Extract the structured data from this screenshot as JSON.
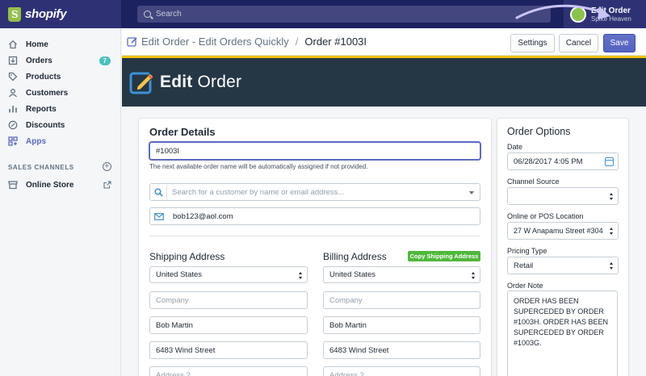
{
  "topbar": {
    "brand": "shopify",
    "search_placeholder": "Search",
    "user_name": "Edit Order",
    "store_name": "Spike Heaven"
  },
  "sidebar": {
    "items": [
      {
        "label": "Home",
        "icon": "home-icon"
      },
      {
        "label": "Orders",
        "icon": "orders-icon",
        "badge": "7"
      },
      {
        "label": "Products",
        "icon": "tag-icon"
      },
      {
        "label": "Customers",
        "icon": "customers-icon"
      },
      {
        "label": "Reports",
        "icon": "reports-icon"
      },
      {
        "label": "Discounts",
        "icon": "discount-icon"
      },
      {
        "label": "Apps",
        "icon": "apps-icon"
      }
    ],
    "section_title": "SALES CHANNELS",
    "channels": [
      {
        "label": "Online Store",
        "icon": "store-icon"
      }
    ]
  },
  "titlebar": {
    "app_name": "Edit Order - Edit Orders Quickly",
    "separator": "/",
    "current": "Order #1003I",
    "settings_label": "Settings",
    "cancel_label": "Cancel",
    "save_label": "Save"
  },
  "banner": {
    "title_bold": "Edit",
    "title_rest": " Order"
  },
  "order_details": {
    "heading": "Order Details",
    "order_name_value": "#1003I",
    "order_name_helper": "The next available order name will be automatically assigned if not provided.",
    "customer_search_placeholder": "Search for a customer by name or email address...",
    "email_value": "bob123@aol.com"
  },
  "shipping": {
    "heading": "Shipping Address",
    "country": "United States",
    "company_placeholder": "Company",
    "name": "Bob Martin",
    "address1": "6483 Wind Street",
    "address2_placeholder": "Address 2"
  },
  "billing": {
    "heading": "Billing Address",
    "copy_button": "Copy Shipping Address",
    "country": "United States",
    "company_placeholder": "Company",
    "name": "Bob Martin",
    "address1": "6483 Wind Street",
    "address2_placeholder": "Address 2"
  },
  "order_options": {
    "heading": "Order Options",
    "date_label": "Date",
    "date_value": "06/28/2017 4:05 PM",
    "channel_label": "Channel Source",
    "channel_value": "",
    "location_label": "Online or POS Location",
    "location_value": "27 W Anapamu Street #304",
    "pricing_label": "Pricing Type",
    "pricing_value": "Retail",
    "note_label": "Order Note",
    "note_value": "ORDER HAS BEEN SUPERCEDED BY ORDER #1003H. ORDER HAS BEEN SUPERCEDED BY ORDER #1003G."
  },
  "colors": {
    "topbar": "#1c2260",
    "accent": "#5c6ac4",
    "banner": "#253645",
    "highlight": "#eec200",
    "green": "#50b83c",
    "badge": "#47c1bf"
  }
}
